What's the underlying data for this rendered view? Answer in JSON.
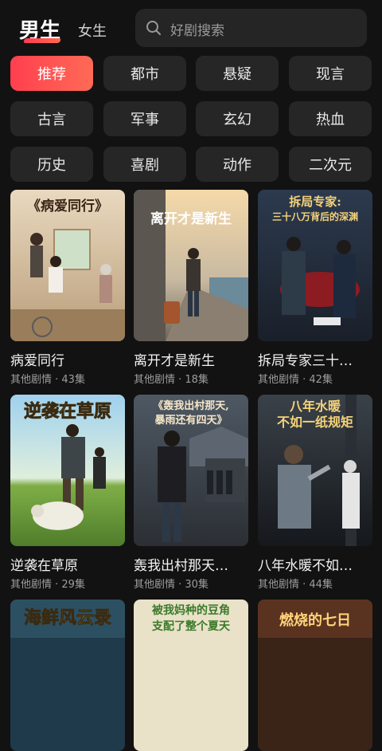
{
  "header": {
    "tab_male": "男生",
    "tab_female": "女生",
    "search_placeholder": "好剧搜索"
  },
  "categories": [
    "推荐",
    "都市",
    "悬疑",
    "现言",
    "古言",
    "军事",
    "玄幻",
    "热血",
    "历史",
    "喜剧",
    "动作",
    "二次元"
  ],
  "active_category": "推荐",
  "dramas": [
    {
      "title": "病爱同行",
      "meta": "其他剧情 · 43集",
      "poster_text": "《病爱同行》"
    },
    {
      "title": "离开才是新生",
      "meta": "其他剧情 · 18集",
      "poster_text": "离开才是新生"
    },
    {
      "title": "拆局专家三十…",
      "meta": "其他剧情 · 42集",
      "poster_text_1": "拆局专家:",
      "poster_text_2": "三十八万背后的深渊"
    },
    {
      "title": "逆袭在草原",
      "meta": "其他剧情 · 29集",
      "poster_text": "逆袭在草原"
    },
    {
      "title": "轰我出村那天…",
      "meta": "其他剧情 · 30集",
      "poster_text_1": "《轰我出村那天,",
      "poster_text_2": "暴雨还有四天》"
    },
    {
      "title": "八年水暖不如…",
      "meta": "其他剧情 · 44集",
      "poster_text_1": "八年水暖",
      "poster_text_2": "不如一纸规矩"
    },
    {
      "poster_text": "海鲜风云录"
    },
    {
      "poster_text_1": "被我妈种的豆角",
      "poster_text_2": "支配了整个夏天"
    },
    {
      "poster_text": "燃烧的七日"
    }
  ],
  "colors": {
    "accent": "#ff4a52",
    "background": "#121212",
    "chip": "#262626"
  }
}
